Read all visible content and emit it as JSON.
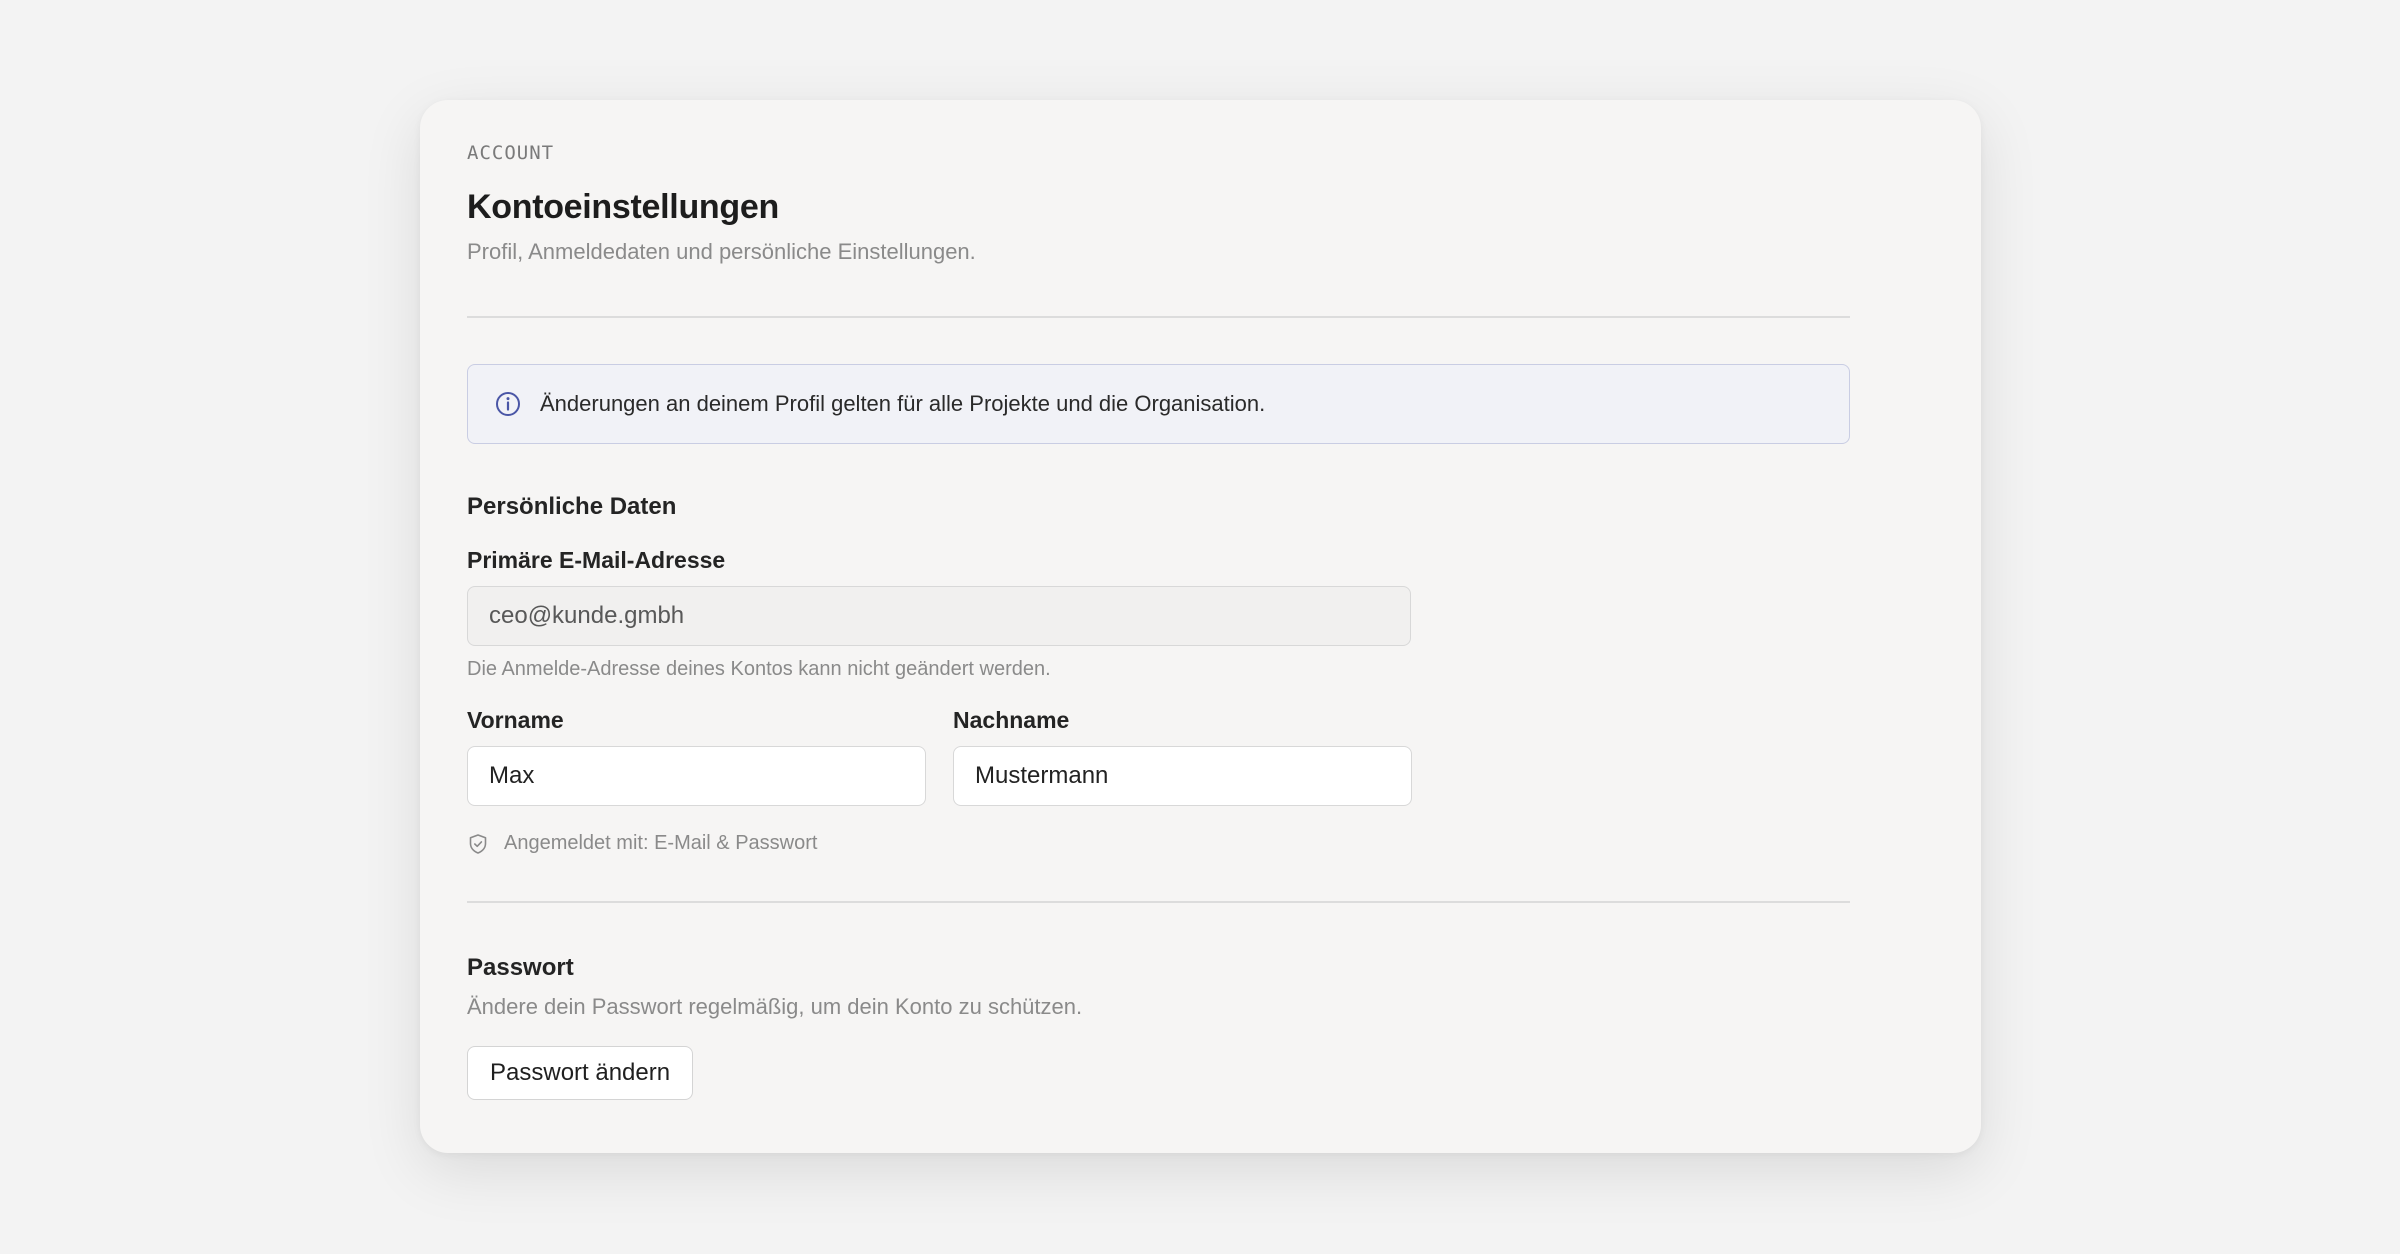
{
  "header": {
    "eyebrow": "ACCOUNT",
    "title": "Kontoeinstellungen",
    "subtitle": "Profil, Anmeldedaten und persönliche Einstellungen."
  },
  "banner": {
    "icon": "info-icon",
    "text": "Änderungen an deinem Profil gelten für alle Projekte und die Organisation."
  },
  "personal": {
    "section_title": "Persönliche Daten",
    "email": {
      "label": "Primäre E-Mail-Adresse",
      "value": "ceo@kunde.gmbh",
      "helper": "Die Anmelde-Adresse deines Kontos kann nicht geändert werden."
    },
    "first_name": {
      "label": "Vorname",
      "value": "Max"
    },
    "last_name": {
      "label": "Nachname",
      "value": "Mustermann"
    },
    "signin": {
      "icon": "shield-check-icon",
      "text": "Angemeldet mit: E-Mail & Passwort"
    }
  },
  "password": {
    "section_title": "Passwort",
    "description": "Ändere dein Passwort regelmäßig, um dein Konto zu schützen.",
    "button_label": "Passwort ändern"
  },
  "colors": {
    "background": "#f3f3f3",
    "card": "#f6f5f4",
    "banner_border": "#c9cde3",
    "banner_bg": "#f1f2f7",
    "info_icon": "#4a56a6",
    "muted_text": "#8a8a8a"
  }
}
